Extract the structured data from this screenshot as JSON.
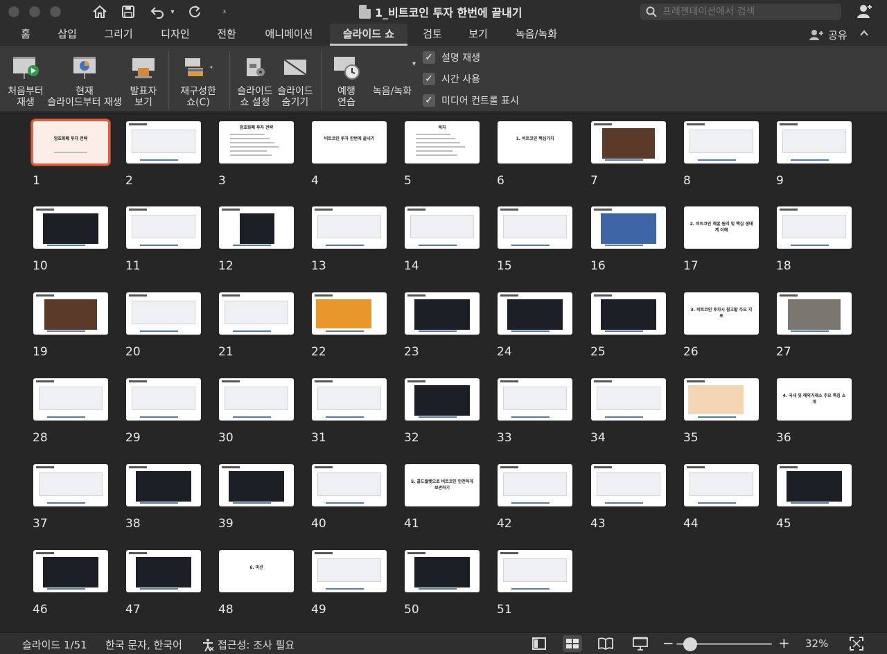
{
  "window": {
    "title": "1_비트코인 투자 한번에 끝내기",
    "search_placeholder": "프레젠테이션에서 검색"
  },
  "tabs": [
    {
      "label": "홈"
    },
    {
      "label": "삽입"
    },
    {
      "label": "그리기"
    },
    {
      "label": "디자인"
    },
    {
      "label": "전환"
    },
    {
      "label": "애니메이션"
    },
    {
      "label": "슬라이드 쇼"
    },
    {
      "label": "검토"
    },
    {
      "label": "보기"
    },
    {
      "label": "녹음/녹화"
    }
  ],
  "share_label": "공유",
  "ribbon": {
    "from_start": "처음부터\n재생",
    "from_current": "현재\n슬라이드부터 재생",
    "presenter_view": "발표자\n보기",
    "custom_show": "재구성한\n쇼(C)",
    "setup_show": "슬라이드\n쇼 설정",
    "hide_slide": "슬라이드\n숨기기",
    "rehearse": "예행\n연습",
    "record": "녹음/녹화",
    "checks": [
      {
        "label": "설명 재생",
        "checked": true
      },
      {
        "label": "시간 사용",
        "checked": true
      },
      {
        "label": "미디어 컨트롤 표시",
        "checked": true
      }
    ]
  },
  "slides": {
    "s1": "암호화폐 투자 전략",
    "s3": "암호화폐 투자 전략",
    "s4": "비트코인 투자 한번에 끝내기",
    "s5": "목차",
    "s6": "1. 비트코인 핵심가치",
    "s17": "2. 비트코인 채굴 원리 및 핵심 생태계 이해",
    "s26": "3. 비트코인 투자시 참고할 주요 지표",
    "s36": "4. 국내 및 해외거래소 주요 특징 소개",
    "s41": "5. 콜드월렛으로 비트코인 안전하게 보관하기",
    "s48": "6. 미션",
    "total": 51,
    "selected": 1
  },
  "status": {
    "slide_counter": "슬라이드 1/51",
    "language": "한국 문자, 한국어",
    "accessibility": "접근성: 조사 필요",
    "zoom": "32%"
  }
}
